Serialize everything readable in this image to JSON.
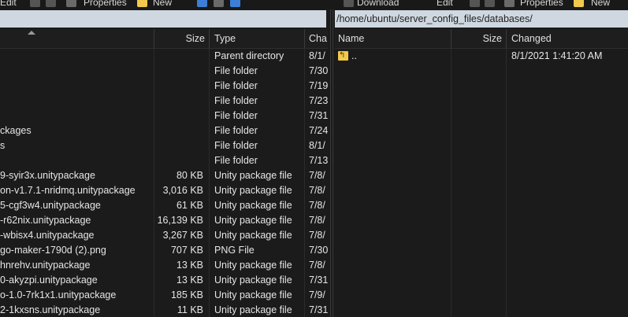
{
  "toolbar_left": {
    "edit_label": "Edit",
    "properties_label": "Properties",
    "new_label": "New"
  },
  "toolbar_right": {
    "download_label": "Download",
    "edit_label": "Edit",
    "properties_label": "Properties",
    "new_label": "New"
  },
  "right_path": "/home/ubuntu/server_config_files/databases/",
  "left_pane": {
    "columns": {
      "size": "Size",
      "type": "Type",
      "changed": "Cha"
    },
    "rows": [
      {
        "name": "",
        "size": "",
        "type": "Parent directory",
        "changed": "8/1/"
      },
      {
        "name": "",
        "size": "",
        "type": "File folder",
        "changed": "7/30"
      },
      {
        "name": "",
        "size": "",
        "type": "File folder",
        "changed": "7/19"
      },
      {
        "name": "",
        "size": "",
        "type": "File folder",
        "changed": "7/23"
      },
      {
        "name": "",
        "size": "",
        "type": "File folder",
        "changed": "7/31"
      },
      {
        "name": "ckages",
        "size": "",
        "type": "File folder",
        "changed": "7/24"
      },
      {
        "name": "s",
        "size": "",
        "type": "File folder",
        "changed": "8/1/"
      },
      {
        "name": "",
        "size": "",
        "type": "File folder",
        "changed": "7/13"
      },
      {
        "name": "9-syir3x.unitypackage",
        "size": "80 KB",
        "type": "Unity package file",
        "changed": "7/8/"
      },
      {
        "name": "on-v1.7.1-nridmq.unitypackage",
        "size": "3,016 KB",
        "type": "Unity package file",
        "changed": "7/8/"
      },
      {
        "name": "5-cgf3w4.unitypackage",
        "size": "61 KB",
        "type": "Unity package file",
        "changed": "7/8/"
      },
      {
        "name": "-r62nix.unitypackage",
        "size": "16,139 KB",
        "type": "Unity package file",
        "changed": "7/8/"
      },
      {
        "name": "-wbisx4.unitypackage",
        "size": "3,267 KB",
        "type": "Unity package file",
        "changed": "7/8/"
      },
      {
        "name": "go-maker-1790d (2).png",
        "size": "707 KB",
        "type": "PNG File",
        "changed": "7/30"
      },
      {
        "name": "hnrehv.unitypackage",
        "size": "13 KB",
        "type": "Unity package file",
        "changed": "7/8/"
      },
      {
        "name": "0-akyzpi.unitypackage",
        "size": "13 KB",
        "type": "Unity package file",
        "changed": "7/31"
      },
      {
        "name": "o-1.0-7rk1x1.unitypackage",
        "size": "185 KB",
        "type": "Unity package file",
        "changed": "7/9/"
      },
      {
        "name": "2-1kxsns.unitypackage",
        "size": "11 KB",
        "type": "Unity package file",
        "changed": "7/31"
      }
    ]
  },
  "right_pane": {
    "columns": {
      "name": "Name",
      "size": "Size",
      "changed": "Changed"
    },
    "rows": [
      {
        "name": "..",
        "size": "",
        "changed": "8/1/2021 1:41:20 AM",
        "icon": "parent-folder-icon"
      }
    ]
  },
  "colors": {
    "background": "#1b1b1b",
    "pathbar": "#cfd8e0",
    "folder": "#f2c94c"
  }
}
